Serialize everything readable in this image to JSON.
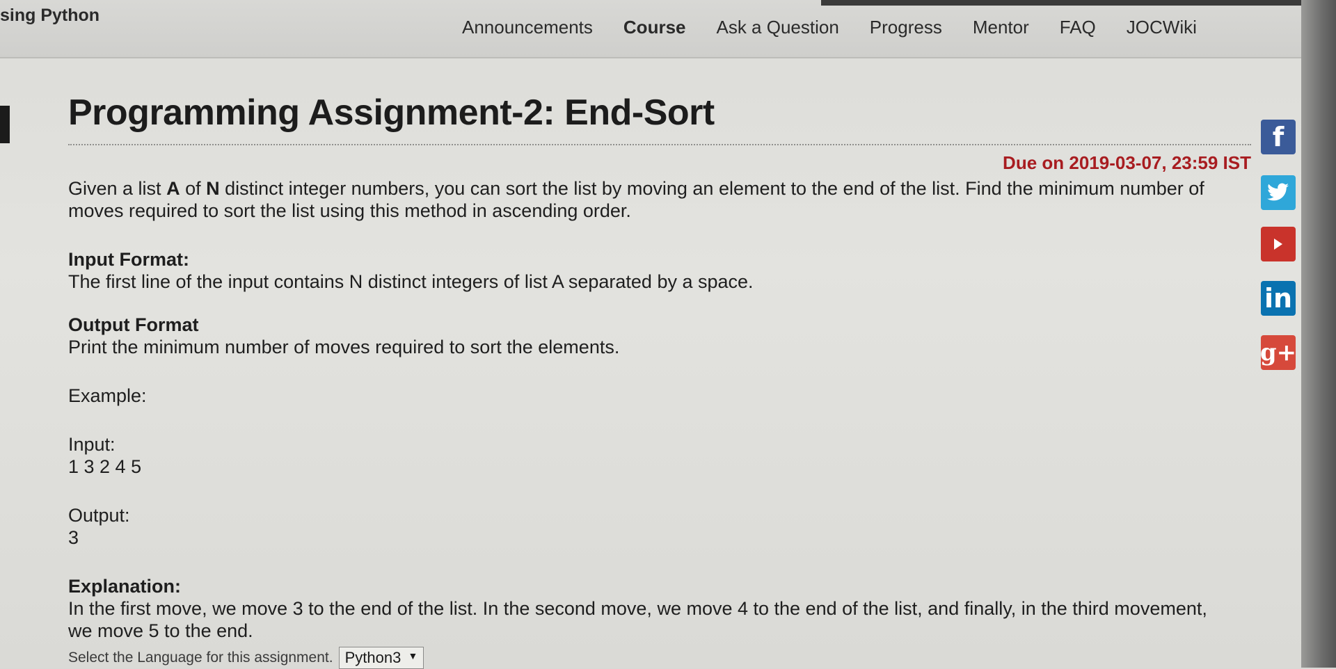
{
  "header": {
    "brand": "sing Python",
    "nav": [
      "Announcements",
      "Course",
      "Ask a Question",
      "Progress",
      "Mentor",
      "FAQ",
      "JOCWiki"
    ]
  },
  "assignment": {
    "title": "Programming Assignment-2: End-Sort",
    "due": "Due on 2019-03-07, 23:59 IST",
    "intro_1": "Given a list ",
    "intro_A": "A",
    "intro_2": " of ",
    "intro_N": "N",
    "intro_3": " distinct integer numbers, you can sort the list by moving an element to the end of the list. Find the minimum number of moves required to sort the list using this method in ascending order.",
    "input_format_heading": "Input Format:",
    "input_format_text": "The first line of the input contains N distinct integers of list A separated by a space.",
    "output_format_heading": "Output Format",
    "output_format_text": "Print the minimum number of moves required to sort the elements.",
    "example_heading": "Example:",
    "input_label": "Input:",
    "input_value": "1 3 2 4 5",
    "output_label": "Output:",
    "output_value": "3",
    "explanation_heading": "Explanation:",
    "explanation_text": "In the first move, we move 3 to the end of the list. In the second move, we move 4 to the end of the list, and finally, in the third movement, we move 5 to the end."
  },
  "language": {
    "label": "Select the Language for this assignment.",
    "selected": "Python3"
  },
  "social": {
    "facebook_glyph": "f",
    "linkedin_glyph": "in",
    "googleplus_glyph": "g+"
  }
}
